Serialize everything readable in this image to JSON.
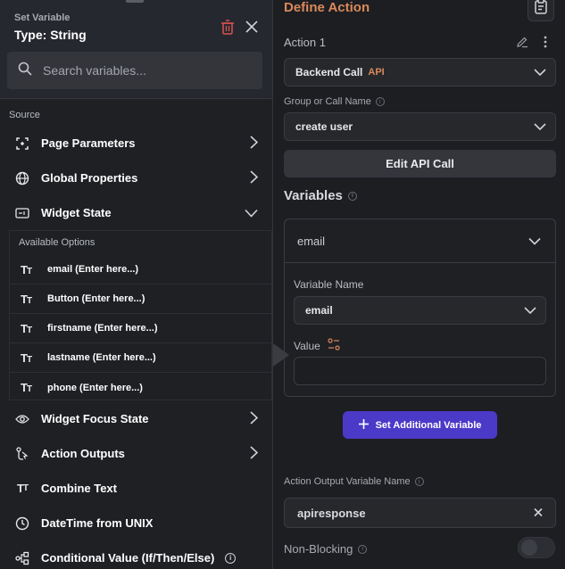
{
  "left_panel": {
    "header_label": "Set Variable",
    "type_label": "Type: String",
    "search_placeholder": "Search variables...",
    "source_label": "Source",
    "nav_items": [
      {
        "label": "Page Parameters",
        "icon": "page-params-icon"
      },
      {
        "label": "Global Properties",
        "icon": "globe-icon"
      },
      {
        "label": "Widget State",
        "icon": "widget-state-icon"
      },
      {
        "label": "Widget Focus State",
        "icon": "eye-icon"
      },
      {
        "label": "Action Outputs",
        "icon": "action-outputs-icon"
      },
      {
        "label": "Combine Text",
        "icon": "text-icon"
      },
      {
        "label": "DateTime from UNIX",
        "icon": "clock-icon"
      },
      {
        "label": "Conditional Value (If/Then/Else)",
        "icon": "conditional-icon"
      }
    ],
    "available_options_label": "Available Options",
    "options": [
      "email (Enter here...)",
      "Button (Enter here...)",
      "firstname (Enter here...)",
      "lastname (Enter here...)",
      "phone (Enter here...)"
    ]
  },
  "right_panel": {
    "title": "Define Action",
    "action_label": "Action 1",
    "action_type": "Backend Call",
    "action_tag": "API",
    "group_label": "Group or Call Name",
    "group_value": "create user",
    "edit_api_label": "Edit API Call",
    "variables_title": "Variables",
    "variable_header": "email",
    "variable_name_label": "Variable Name",
    "variable_name_value": "email",
    "value_label": "Value",
    "value_input": "",
    "set_additional_label": "Set Additional Variable",
    "output_label": "Action Output Variable Name",
    "output_value": "apiresponse",
    "non_blocking_label": "Non-Blocking",
    "non_blocking_on": false
  },
  "colors": {
    "accent_orange": "#d9895a",
    "primary_button": "#4b39c8",
    "trash_red": "#d9534f"
  }
}
